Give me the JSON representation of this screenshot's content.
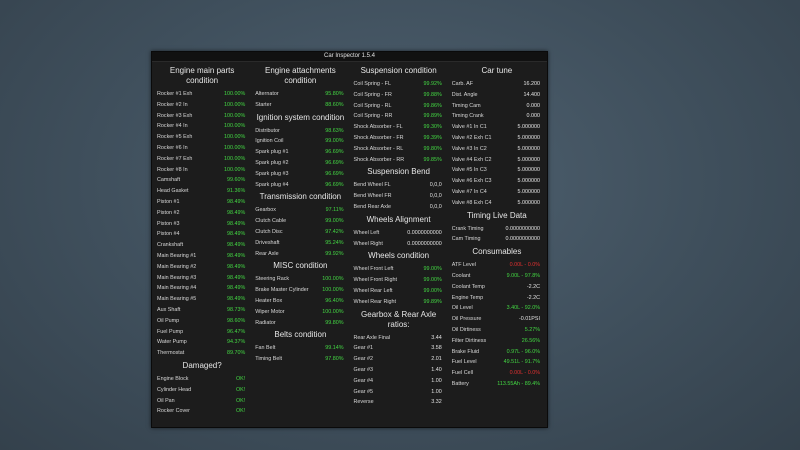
{
  "window": {
    "title": "Car Inspector 1.5.4"
  },
  "col1": {
    "engine": {
      "title": "Engine main parts condition",
      "rows": [
        {
          "label": "Rocker #1 Exh",
          "value": "100.00%",
          "color": "green"
        },
        {
          "label": "Rocker #2 In",
          "value": "100.00%",
          "color": "green"
        },
        {
          "label": "Rocker #3 Exh",
          "value": "100.00%",
          "color": "green"
        },
        {
          "label": "Rocker #4 In",
          "value": "100.00%",
          "color": "green"
        },
        {
          "label": "Rocker #5 Exh",
          "value": "100.00%",
          "color": "green"
        },
        {
          "label": "Rocker #6 In",
          "value": "100.00%",
          "color": "green"
        },
        {
          "label": "Rocker #7 Exh",
          "value": "100.00%",
          "color": "green"
        },
        {
          "label": "Rocker #8 In",
          "value": "100.00%",
          "color": "green"
        },
        {
          "label": "Camshaft",
          "value": "99.60%",
          "color": "green"
        },
        {
          "label": "Head Gasket",
          "value": "91.36%",
          "color": "green"
        },
        {
          "label": "Piston #1",
          "value": "98.49%",
          "color": "green"
        },
        {
          "label": "Piston #2",
          "value": "98.49%",
          "color": "green"
        },
        {
          "label": "Piston #3",
          "value": "98.49%",
          "color": "green"
        },
        {
          "label": "Piston #4",
          "value": "98.49%",
          "color": "green"
        },
        {
          "label": "Crankshaft",
          "value": "98.49%",
          "color": "green"
        },
        {
          "label": "Main Bearing #1",
          "value": "98.49%",
          "color": "green"
        },
        {
          "label": "Main Bearing #2",
          "value": "98.49%",
          "color": "green"
        },
        {
          "label": "Main Bearing #3",
          "value": "98.49%",
          "color": "green"
        },
        {
          "label": "Main Bearing #4",
          "value": "98.49%",
          "color": "green"
        },
        {
          "label": "Main Bearing #5",
          "value": "98.49%",
          "color": "green"
        },
        {
          "label": "Aux Shaft",
          "value": "98.73%",
          "color": "green"
        },
        {
          "label": "Oil Pump",
          "value": "98.60%",
          "color": "green"
        },
        {
          "label": "Fuel Pump",
          "value": "96.47%",
          "color": "green"
        },
        {
          "label": "Water Pump",
          "value": "94.37%",
          "color": "green"
        },
        {
          "label": "Thermostat",
          "value": "89.70%",
          "color": "green"
        }
      ]
    },
    "damaged": {
      "title": "Damaged?",
      "rows": [
        {
          "label": "Engine Block",
          "value": "OK!",
          "color": "green"
        },
        {
          "label": "Cylinder Head",
          "value": "OK!",
          "color": "green"
        },
        {
          "label": "Oil Pan",
          "value": "OK!",
          "color": "green"
        },
        {
          "label": "Rocker Cover",
          "value": "OK!",
          "color": "green"
        }
      ]
    }
  },
  "col2": {
    "attach": {
      "title": "Engine attachments condition",
      "rows": [
        {
          "label": "Alternator",
          "value": "95.80%",
          "color": "green"
        },
        {
          "label": "Starter",
          "value": "88.60%",
          "color": "green"
        }
      ]
    },
    "ignition": {
      "title": "Ignition system condition",
      "rows": [
        {
          "label": "Distributor",
          "value": "98.63%",
          "color": "green"
        },
        {
          "label": "Ignition Coil",
          "value": "99.00%",
          "color": "green"
        },
        {
          "label": "Spark plug #1",
          "value": "96.69%",
          "color": "green"
        },
        {
          "label": "Spark plug #2",
          "value": "96.69%",
          "color": "green"
        },
        {
          "label": "Spark plug #3",
          "value": "96.69%",
          "color": "green"
        },
        {
          "label": "Spark plug #4",
          "value": "96.69%",
          "color": "green"
        }
      ]
    },
    "transmission": {
      "title": "Transmission condition",
      "rows": [
        {
          "label": "Gearbox",
          "value": "97.11%",
          "color": "green"
        },
        {
          "label": "Clutch Cable",
          "value": "99.00%",
          "color": "green"
        },
        {
          "label": "Clutch Disc",
          "value": "97.42%",
          "color": "green"
        },
        {
          "label": "Driveshaft",
          "value": "95.24%",
          "color": "green"
        },
        {
          "label": "Rear Axle",
          "value": "99.92%",
          "color": "green"
        }
      ]
    },
    "misc": {
      "title": "MISC condition",
      "rows": [
        {
          "label": "Steering Rack",
          "value": "100.00%",
          "color": "green"
        },
        {
          "label": "Brake Master Cylinder",
          "value": "100.00%",
          "color": "green"
        },
        {
          "label": "Heater Box",
          "value": "96.40%",
          "color": "green"
        },
        {
          "label": "Wiper Motor",
          "value": "100.00%",
          "color": "green"
        },
        {
          "label": "Radiator",
          "value": "99.80%",
          "color": "green"
        }
      ]
    },
    "belts": {
      "title": "Belts condition",
      "rows": [
        {
          "label": "Fan Belt",
          "value": "99.14%",
          "color": "green"
        },
        {
          "label": "Timing Belt",
          "value": "97.80%",
          "color": "green"
        }
      ]
    }
  },
  "col3": {
    "suspension": {
      "title": "Suspension condition",
      "rows": [
        {
          "label": "Coil Spring - FL",
          "value": "99.92%",
          "color": "green"
        },
        {
          "label": "Coil Spring - FR",
          "value": "99.88%",
          "color": "green"
        },
        {
          "label": "Coil Spring - RL",
          "value": "99.86%",
          "color": "green"
        },
        {
          "label": "Coil Spring - RR",
          "value": "99.89%",
          "color": "green"
        },
        {
          "label": "Shock Absorber - FL",
          "value": "99.30%",
          "color": "green"
        },
        {
          "label": "Shock Absorber - FR",
          "value": "99.39%",
          "color": "green"
        },
        {
          "label": "Shock Absorber - RL",
          "value": "99.80%",
          "color": "green"
        },
        {
          "label": "Shock Absorber - RR",
          "value": "99.85%",
          "color": "green"
        }
      ]
    },
    "bend": {
      "title": "Suspension Bend",
      "rows": [
        {
          "label": "Bend Wheel FL",
          "value": "0,0,0",
          "color": "white"
        },
        {
          "label": "Bend Wheel FR",
          "value": "0,0,0",
          "color": "white"
        },
        {
          "label": "Bend Rear Axle",
          "value": "0,0,0",
          "color": "white"
        }
      ]
    },
    "alignment": {
      "title": "Wheels Alignment",
      "rows": [
        {
          "label": "Wheel Left",
          "value": "0.0000000000",
          "color": "white"
        },
        {
          "label": "Wheel Right",
          "value": "0.0000000000",
          "color": "white"
        }
      ]
    },
    "wheels": {
      "title": "Wheels condition",
      "rows": [
        {
          "label": "Wheel Front Left",
          "value": "99.00%",
          "color": "green"
        },
        {
          "label": "Wheel Front Right",
          "value": "99.00%",
          "color": "green"
        },
        {
          "label": "Wheel Rear Left",
          "value": "99.00%",
          "color": "green"
        },
        {
          "label": "Wheel Rear Right",
          "value": "99.89%",
          "color": "green"
        }
      ]
    },
    "ratios": {
      "title": "Gearbox & Rear Axle ratios:",
      "rows": [
        {
          "label": "Rear Axle Final",
          "value": "3.44",
          "color": "white"
        },
        {
          "label": "Gear #1",
          "value": "3.58",
          "color": "white"
        },
        {
          "label": "Gear #2",
          "value": "2.01",
          "color": "white"
        },
        {
          "label": "Gear #3",
          "value": "1.40",
          "color": "white"
        },
        {
          "label": "Gear #4",
          "value": "1.00",
          "color": "white"
        },
        {
          "label": "Gear #5",
          "value": "1.00",
          "color": "white"
        },
        {
          "label": "Reverse",
          "value": "3.32",
          "color": "white"
        }
      ]
    }
  },
  "col4": {
    "tune": {
      "title": "Car tune",
      "rows": [
        {
          "label": "Carb. AF",
          "value": "16.200",
          "color": "white"
        },
        {
          "label": "Dist. Angle",
          "value": "14.400",
          "color": "white"
        },
        {
          "label": "Timing Cam",
          "value": "0.000",
          "color": "white"
        },
        {
          "label": "Timing Crank",
          "value": "0.000",
          "color": "white"
        },
        {
          "label": "Valve #1 In C1",
          "value": "5.000000",
          "color": "white"
        },
        {
          "label": "Valve #2 Exh C1",
          "value": "5.000000",
          "color": "white"
        },
        {
          "label": "Valve #3 In C2",
          "value": "5.000000",
          "color": "white"
        },
        {
          "label": "Valve #4 Exh C2",
          "value": "5.000000",
          "color": "white"
        },
        {
          "label": "Valve #5 In C3",
          "value": "5.000000",
          "color": "white"
        },
        {
          "label": "Valve #6 Exh C3",
          "value": "5.000000",
          "color": "white"
        },
        {
          "label": "Valve #7 In C4",
          "value": "5.000000",
          "color": "white"
        },
        {
          "label": "Valve #8 Exh C4",
          "value": "5.000000",
          "color": "white"
        }
      ]
    },
    "timing": {
      "title": "Timing Live Data",
      "rows": [
        {
          "label": "Crank Timing",
          "value": "0.0000000000",
          "color": "white"
        },
        {
          "label": "Cam Timing",
          "value": "0.0000000000",
          "color": "white"
        }
      ]
    },
    "consumables": {
      "title": "Consumables",
      "rows": [
        {
          "label": "ATF Level",
          "value": "0.00L - 0.0%",
          "color": "red"
        },
        {
          "label": "Coolant",
          "value": "9.00L - 97.8%",
          "color": "green"
        },
        {
          "label": "Coolant Temp",
          "value": "-2.2C",
          "color": "white"
        },
        {
          "label": "Engine Temp",
          "value": "-2.2C",
          "color": "white"
        },
        {
          "label": "Oil Level",
          "value": "3.40L - 92.0%",
          "color": "green"
        },
        {
          "label": "Oil Pressure",
          "value": "-0.01PSI",
          "color": "white"
        },
        {
          "label": "Oil Dirtiness",
          "value": "5.27%",
          "color": "green"
        },
        {
          "label": "Filter Dirtiness",
          "value": "26.56%",
          "color": "green"
        },
        {
          "label": "Brake Fluid",
          "value": "0.97L - 96.0%",
          "color": "green"
        },
        {
          "label": "Fuel Level",
          "value": "49.51L - 91.7%",
          "color": "green"
        },
        {
          "label": "Fuel Cell",
          "value": "0.00L - 0.0%",
          "color": "red"
        },
        {
          "label": "Battery",
          "value": "113.55Ah - 89.4%",
          "color": "green"
        }
      ]
    }
  }
}
